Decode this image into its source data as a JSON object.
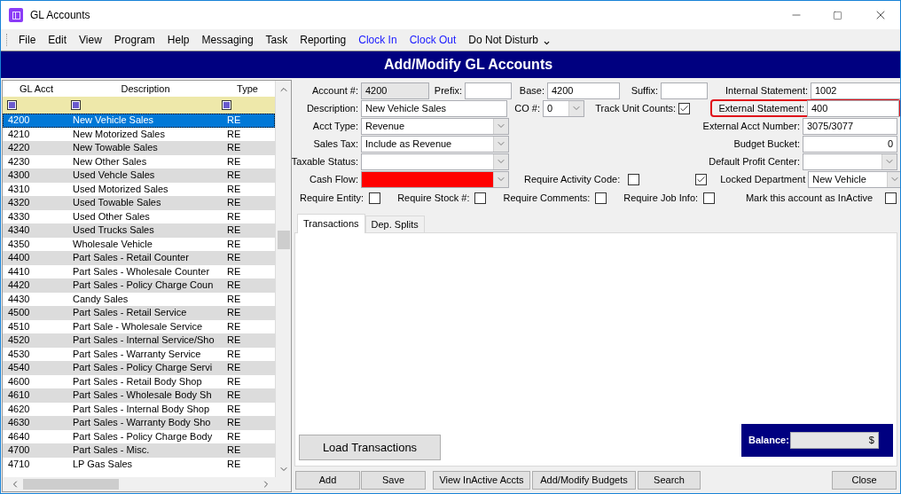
{
  "window": {
    "title": "GL Accounts"
  },
  "menu": [
    {
      "label": "File",
      "kind": "menu"
    },
    {
      "label": "Edit",
      "kind": "menu"
    },
    {
      "label": "View",
      "kind": "menu"
    },
    {
      "label": "Program",
      "kind": "menu"
    },
    {
      "label": "Help",
      "kind": "menu"
    },
    {
      "label": "Messaging",
      "kind": "menu"
    },
    {
      "label": "Task",
      "kind": "menu"
    },
    {
      "label": "Reporting",
      "kind": "menu"
    },
    {
      "label": "Clock In",
      "kind": "link"
    },
    {
      "label": "Clock Out",
      "kind": "link"
    },
    {
      "label": "Do Not Disturb",
      "kind": "dropdown"
    }
  ],
  "header": {
    "title": "Add/Modify GL Accounts"
  },
  "accounts": {
    "columns": [
      "GL Acct",
      "Description",
      "Type"
    ],
    "rows": [
      {
        "acct": "4200",
        "description": "New Vehicle Sales",
        "type": "RE",
        "selected": true
      },
      {
        "acct": "4210",
        "description": "New Motorized Sales",
        "type": "RE",
        "selected": false
      },
      {
        "acct": "4220",
        "description": "New Towable Sales",
        "type": "RE",
        "selected": false
      },
      {
        "acct": "4230",
        "description": "New Other Sales",
        "type": "RE",
        "selected": false
      },
      {
        "acct": "4300",
        "description": "Used Vehcle Sales",
        "type": "RE",
        "selected": false
      },
      {
        "acct": "4310",
        "description": "Used Motorized Sales",
        "type": "RE",
        "selected": false
      },
      {
        "acct": "4320",
        "description": "Used Towable Sales",
        "type": "RE",
        "selected": false
      },
      {
        "acct": "4330",
        "description": "Used Other Sales",
        "type": "RE",
        "selected": false
      },
      {
        "acct": "4340",
        "description": "Used Trucks Sales",
        "type": "RE",
        "selected": false
      },
      {
        "acct": "4350",
        "description": "Wholesale Vehicle",
        "type": "RE",
        "selected": false
      },
      {
        "acct": "4400",
        "description": "Part Sales - Retail Counter",
        "type": "RE",
        "selected": false
      },
      {
        "acct": "4410",
        "description": "Part Sales - Wholesale Counter",
        "type": "RE",
        "selected": false
      },
      {
        "acct": "4420",
        "description": "Part Sales - Policy Charge Coun",
        "type": "RE",
        "selected": false
      },
      {
        "acct": "4430",
        "description": "Candy Sales",
        "type": "RE",
        "selected": false
      },
      {
        "acct": "4500",
        "description": "Part Sales - Retail Service",
        "type": "RE",
        "selected": false
      },
      {
        "acct": "4510",
        "description": "Part Sale - Wholesale Service",
        "type": "RE",
        "selected": false
      },
      {
        "acct": "4520",
        "description": "Part Sales - Internal Service/Sho",
        "type": "RE",
        "selected": false
      },
      {
        "acct": "4530",
        "description": "Part Sales - Warranty Service",
        "type": "RE",
        "selected": false
      },
      {
        "acct": "4540",
        "description": "Part Sales - Policy Charge Servi",
        "type": "RE",
        "selected": false
      },
      {
        "acct": "4600",
        "description": "Part Sales - Retail Body Shop",
        "type": "RE",
        "selected": false
      },
      {
        "acct": "4610",
        "description": "Part Sales - Wholesale Body Sh",
        "type": "RE",
        "selected": false
      },
      {
        "acct": "4620",
        "description": "Part Sales - Internal Body Shop",
        "type": "RE",
        "selected": false
      },
      {
        "acct": "4630",
        "description": "Part Sales - Warranty Body Sho",
        "type": "RE",
        "selected": false
      },
      {
        "acct": "4640",
        "description": "Part Sales - Policy Charge Body",
        "type": "RE",
        "selected": false
      },
      {
        "acct": "4700",
        "description": "Part Sales - Misc.",
        "type": "RE",
        "selected": false
      },
      {
        "acct": "4710",
        "description": "LP Gas Sales",
        "type": "RE",
        "selected": false
      }
    ]
  },
  "form": {
    "account_number": {
      "label": "Account #:",
      "value": "4200",
      "disabled": true
    },
    "prefix": {
      "label": "Prefix:"
    },
    "base": {
      "label": "Base:",
      "value": "4200"
    },
    "suffix": {
      "label": "Suffix:"
    },
    "internal_statement": {
      "label": "Internal Statement:",
      "value": "1002"
    },
    "description": {
      "label": "Description:",
      "value": "New Vehicle Sales"
    },
    "co_number": {
      "label": "CO #:",
      "value": "0"
    },
    "track_unit_counts": {
      "label": "Track Unit Counts:",
      "checked": true
    },
    "external_statement": {
      "label": "External Statement:",
      "value": "400",
      "highlighted": true
    },
    "acct_type": {
      "label": "Acct Type:",
      "value": "Revenue"
    },
    "external_acct_number": {
      "label": "External Acct Number:",
      "value": "3075/3077"
    },
    "sales_tax": {
      "label": "Sales Tax:",
      "value": "Include as Revenue"
    },
    "budget_bucket": {
      "label": "Budget Bucket:",
      "value": "0"
    },
    "taxable_status": {
      "label": "Taxable Status:"
    },
    "default_profit_center": {
      "label": "Default Profit Center:"
    },
    "cash_flow": {
      "label": "Cash Flow:",
      "color": "#ff0000"
    },
    "require_activity_code": {
      "label": "Require Activity Code:",
      "checked": false
    },
    "locked_department": {
      "label": "Locked Department",
      "checked": true,
      "value": "New Vehicle"
    },
    "requirements": [
      {
        "label": "Require Entity:",
        "checked": false
      },
      {
        "label": "Require Stock #:",
        "checked": false
      },
      {
        "label": "Require Comments:",
        "checked": false
      },
      {
        "label": "Require Job Info:",
        "checked": false
      }
    ],
    "inactive": {
      "label": "Mark this account as InActive",
      "checked": false
    }
  },
  "tabs": [
    {
      "label": "Transactions",
      "selected": true
    },
    {
      "label": "Dep. Splits",
      "selected": false
    }
  ],
  "load_button": "Load Transactions",
  "balance": {
    "label": "Balance:",
    "value": "$"
  },
  "buttons": [
    "Add",
    "Save",
    "View InActive Accts",
    "Add/Modify Budgets",
    "Search"
  ],
  "close_button": "Close"
}
